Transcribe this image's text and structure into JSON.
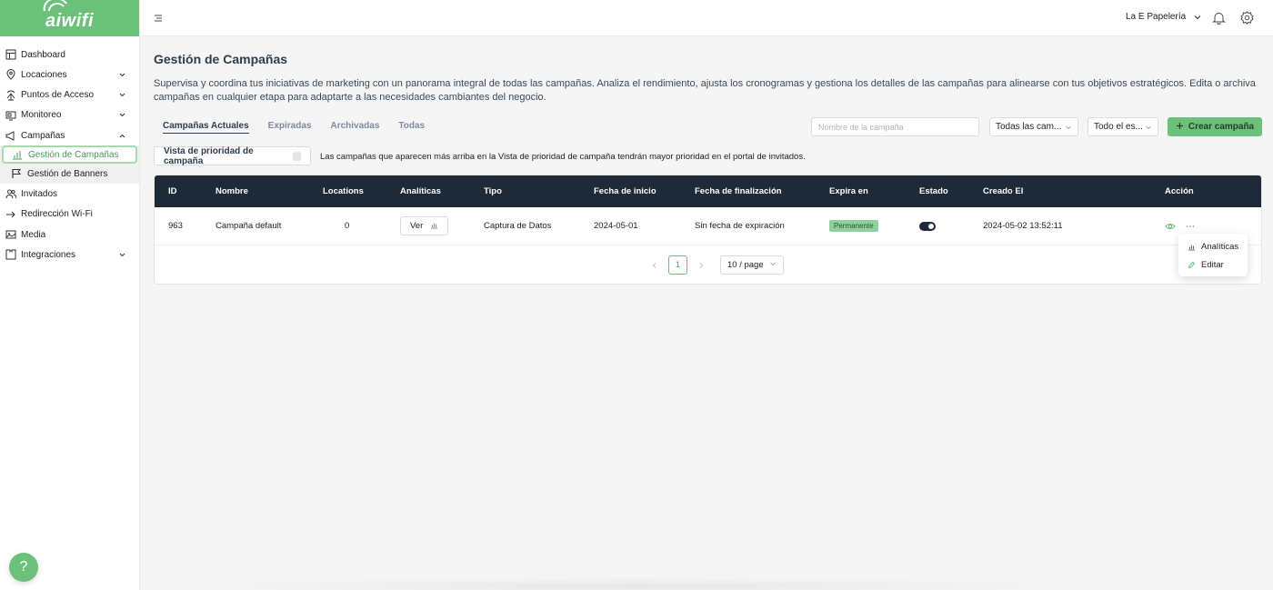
{
  "brand": {
    "logo_text": "aiwifi",
    "primary_color": "#6cc17a",
    "dark_color": "#1f2a38"
  },
  "sidebar": {
    "items": [
      {
        "label": "Dashboard",
        "icon": "dashboard-icon"
      },
      {
        "label": "Locaciones",
        "icon": "location-pin-icon",
        "expandable": true
      },
      {
        "label": "Puntos de Acceso",
        "icon": "router-icon",
        "expandable": true
      },
      {
        "label": "Monitoreo",
        "icon": "monitor-icon",
        "expandable": true
      },
      {
        "label": "Campañas",
        "icon": "megaphone-icon",
        "expandable": true,
        "expanded": true
      },
      {
        "label": "Invitados",
        "icon": "users-icon"
      },
      {
        "label": "Redirección Wi-Fi",
        "icon": "redirect-icon"
      },
      {
        "label": "Media",
        "icon": "image-icon"
      },
      {
        "label": "Integraciones",
        "icon": "puzzle-icon",
        "expandable": true
      }
    ],
    "sub_items": [
      {
        "label": "Gestión de Campañas",
        "icon": "chart-icon",
        "active": true
      },
      {
        "label": "Gestión de Banners",
        "icon": "flag-icon"
      }
    ],
    "help_label": "?"
  },
  "header": {
    "org_name": "La E Papelería"
  },
  "page": {
    "title": "Gestión de Campañas",
    "description": "Supervisa y coordina tus iniciativas de marketing con un panorama integral de todas las campañas. Analiza el rendimiento, ajusta los cronogramas y gestiona los detalles de las campañas para alinearse con tus objetivos estratégicos. Edita o archiva campañas en cualquier etapa para adaptarte a las necesidades cambiantes del negocio."
  },
  "tabs": [
    {
      "label": "Campañas Actuales",
      "active": true
    },
    {
      "label": "Expiradas"
    },
    {
      "label": "Archivadas"
    },
    {
      "label": "Todas"
    }
  ],
  "filters": {
    "search_placeholder": "Nombre de la campaña",
    "type_select": "Todas las cam...",
    "state_select": "Todo el es...",
    "create_label": "Crear campaña"
  },
  "priority": {
    "button_label": "Vista de prioridad de campaña",
    "note": "Las campañas que aparecen más arriba en la Vista de prioridad de campaña tendrán mayor prioridad en el portal de invitados."
  },
  "table": {
    "headers": {
      "id": "ID",
      "name": "Nombre",
      "locations": "Locations",
      "analytics": "Analíticas",
      "type": "Tipo",
      "start": "Fecha de inicio",
      "end": "Fecha de finalización",
      "expires": "Expira en",
      "state": "Estado",
      "created": "Creado El",
      "action": "Acción"
    },
    "rows": [
      {
        "id": "963",
        "name": "Campaña default",
        "locations": "0",
        "analytics_label": "Ver",
        "type": "Captura de Datos",
        "start": "2024-05-01",
        "end": "Sin fecha de expiración",
        "expires": "Permanente",
        "state_on": true,
        "created": "2024-05-02 13:52:11"
      }
    ]
  },
  "pagination": {
    "current_page": "1",
    "page_size": "10 / page"
  },
  "action_menu": {
    "analytics": "Analíticas",
    "edit": "Editar"
  }
}
